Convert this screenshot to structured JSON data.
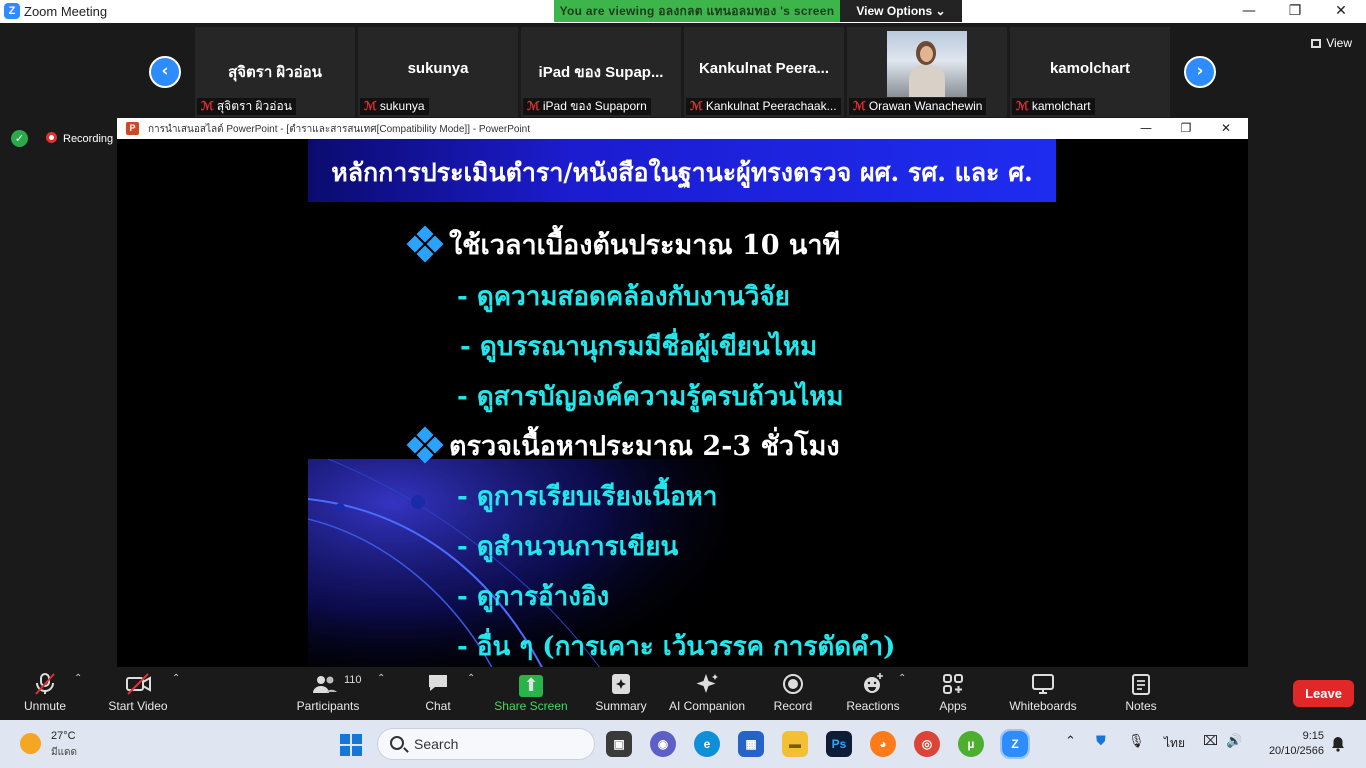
{
  "window": {
    "title": "Zoom Meeting",
    "viewing_message": "You are viewing อลงกลต แทนอลมทอง 's screen",
    "view_options": "View Options"
  },
  "strip": {
    "view_label": "View",
    "participants": [
      {
        "display": "สุจิตรา ผิวอ่อน",
        "name": "สุจิตรา ผิวอ่อน"
      },
      {
        "display": "sukunya",
        "name": "sukunya"
      },
      {
        "display": "iPad ของ Supap...",
        "name": "iPad ของ Supaporn"
      },
      {
        "display": "Kankulnat  Peera...",
        "name": "Kankulnat Peerachaak..."
      },
      {
        "display": "",
        "name": "Orawan Wanachewin"
      },
      {
        "display": "kamolchart",
        "name": "kamolchart"
      }
    ]
  },
  "recording": {
    "label": "Recording"
  },
  "powerpoint": {
    "title": "การนำเสนอสไลด์ PowerPoint - [ตำราและสารสนเทศ[Compatibility Mode]] - PowerPoint",
    "slide": {
      "title": "หลักการประเมินตำรา/หนังสือในฐานะผู้ทรงตรวจ ผศ. รศ. และ ศ.",
      "bullets": [
        {
          "text": "ใช้เวลาเบื้องต้นประมาณ 10 นาที"
        },
        {
          "text": "ตรวจเนื้อหาประมาณ 2-3  ชั่วโมง"
        }
      ],
      "subs": [
        "- ดูความสอดคล้องกับงานวิจัย",
        "- ดูบรรณานุกรมมีชื่อผู้เขียนไหม",
        "- ดูสารบัญองค์ความรู้ครบถ้วนไหม",
        "- ดูการเรียบเรียงเนื้อหา",
        "- ดูสำนวนการเขียน",
        "- ดูการอ้างอิง",
        "- อื่น ๆ (การเคาะ เว้นวรรค การตัดคำ)"
      ]
    }
  },
  "toolbar": {
    "unmute": "Unmute",
    "start_video": "Start Video",
    "participants": "Participants",
    "participant_count": "110",
    "chat": "Chat",
    "share_screen": "Share Screen",
    "summary": "Summary",
    "ai_companion": "AI Companion",
    "record": "Record",
    "reactions": "Reactions",
    "apps": "Apps",
    "whiteboards": "Whiteboards",
    "notes": "Notes",
    "leave": "Leave"
  },
  "taskbar": {
    "temperature": "27°C",
    "condition": "มีแดด",
    "search_placeholder": "Search",
    "language": "ไทย",
    "time": "9:15",
    "date": "20/10/2566"
  },
  "colors": {
    "zoom_blue": "#2d8cff",
    "banner_green": "#3db54a",
    "leave_red": "#e02828",
    "slide_cyan": "#22e8ee",
    "slide_title_blue": "#1e2cf0"
  }
}
